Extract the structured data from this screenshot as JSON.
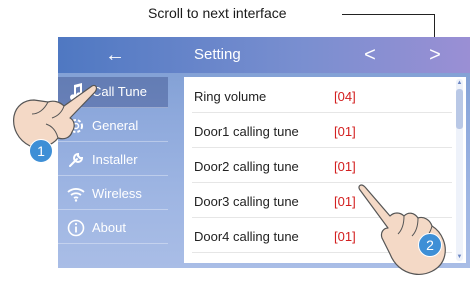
{
  "annotation": {
    "text": "Scroll to next interface"
  },
  "topbar": {
    "back_icon": "←",
    "title": "Setting",
    "prev_icon": "<",
    "next_icon": ">"
  },
  "sidebar": {
    "items": [
      {
        "label": "Call Tune",
        "icon": "music-note-icon",
        "active": true
      },
      {
        "label": "General",
        "icon": "gear-icon",
        "active": false
      },
      {
        "label": "Installer",
        "icon": "wrench-icon",
        "active": false
      },
      {
        "label": "Wireless",
        "icon": "wifi-icon",
        "active": false
      },
      {
        "label": "About",
        "icon": "info-icon",
        "active": false
      }
    ]
  },
  "settings": {
    "rows": [
      {
        "name": "Ring volume",
        "value": "[04]"
      },
      {
        "name": "Door1 calling tune",
        "value": "[01]"
      },
      {
        "name": "Door2 calling tune",
        "value": "[01]"
      },
      {
        "name": "Door3 calling tune",
        "value": "[01]"
      },
      {
        "name": "Door4 calling tune",
        "value": "[01]"
      }
    ]
  },
  "badges": {
    "first": "1",
    "second": "2"
  },
  "colors": {
    "value_red": "#d32020",
    "topbar_blue": "#4f78c2",
    "badge_blue": "#3e8fd6"
  }
}
